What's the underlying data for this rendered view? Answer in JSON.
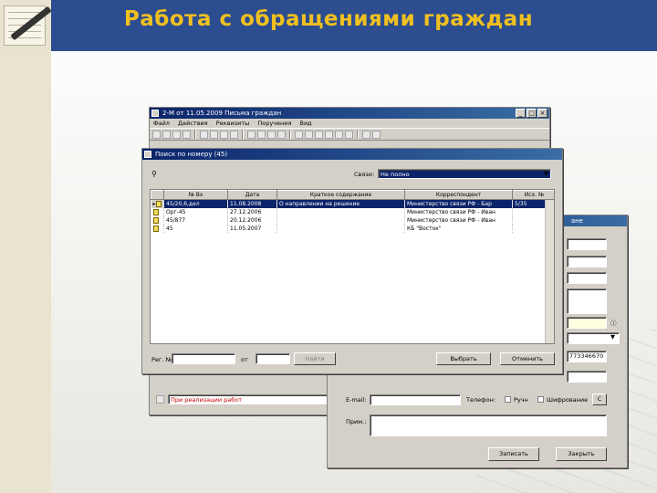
{
  "slide": {
    "title": "Работа с обращениями граждан"
  },
  "main_window": {
    "title": "2-М от 11.05.2009 Письма граждан",
    "menu": [
      "Файл",
      "Действия",
      "Реквизиты",
      "Поручения",
      "Вид"
    ],
    "bottom_status": "При реализации работ"
  },
  "search_dialog": {
    "title": "Поиск по номеру (45)",
    "link_label": "Связи:",
    "link_value": "Не полно",
    "columns": [
      "№ Вх",
      "Дата",
      "Краткое содержание",
      "Корреспондент",
      "Исх. №"
    ],
    "rows": [
      {
        "num": "45/20,6,дел",
        "date": "11.08.2008",
        "summary": "О направлении на решение",
        "correspondent": "Министерство связи РФ - Бар",
        "out": "5/35"
      },
      {
        "num": "Орг-45",
        "date": "27.12.2006",
        "summary": "",
        "correspondent": "Министерство связи РФ - Иван",
        "out": ""
      },
      {
        "num": "45/877",
        "date": "20.12.2006",
        "summary": "",
        "correspondent": "Министерство связи РФ - Иван",
        "out": ""
      },
      {
        "num": "45",
        "date": "11.05.2007",
        "summary": "",
        "correspondent": "КБ \"Восток\"",
        "out": ""
      }
    ],
    "reg_label": "Рег. №",
    "from_label": "от",
    "find_button": "Найти",
    "select_button": "Выбрать",
    "cancel_button": "Отменить"
  },
  "card_window": {
    "title_tail": "ане",
    "phone_value": "773346670",
    "email_label": "E-mail:",
    "phone_label": "Телефон:",
    "checkbox1_label": "Ручн",
    "checkbox2_label": "Шифрование",
    "note_label": "Прим.:",
    "save_button": "Записать",
    "close_button": "Закрыть",
    "c_label": "С"
  }
}
